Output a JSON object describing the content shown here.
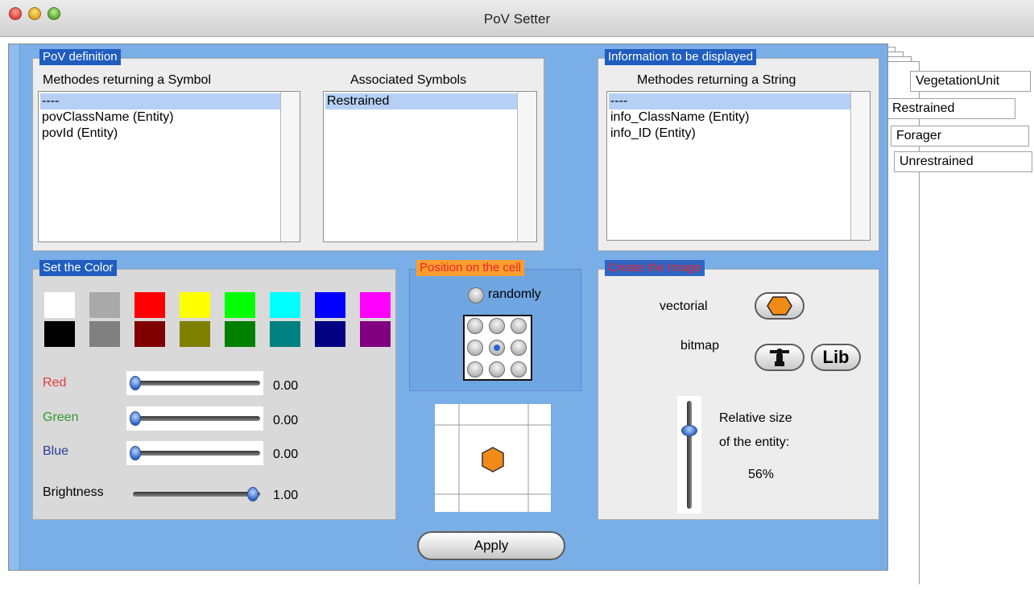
{
  "window": {
    "title": "PoV Setter"
  },
  "tabs": [
    "VegetationUnit",
    "Restrained",
    "Forager",
    "Unrestrained"
  ],
  "pov_definition": {
    "title": "PoV definition",
    "methods_label": "Methodes returning a Symbol",
    "methods": [
      "----",
      "povClassName (Entity)",
      "povId (Entity)"
    ],
    "symbols_label": "Associated Symbols",
    "symbols": [
      "Restrained"
    ]
  },
  "information": {
    "title": "Information to be displayed",
    "methods_label": "Methodes returning a String",
    "methods": [
      "----",
      "info_ClassName (Entity)",
      "info_ID (Entity)"
    ]
  },
  "color": {
    "title": "Set the Color",
    "swatches_top": [
      "#ffffff",
      "#a9a9a9",
      "#ff0000",
      "#ffff00",
      "#00ff00",
      "#00ffff",
      "#0000ff",
      "#ff00ff"
    ],
    "swatches_bottom": [
      "#000000",
      "#808080",
      "#800000",
      "#808000",
      "#008000",
      "#008080",
      "#000080",
      "#800080"
    ],
    "red_label": "Red",
    "red_value": "0.00",
    "red_color": "#e33b3b",
    "green_label": "Green",
    "green_value": "0.00",
    "green_color": "#2f9a2f",
    "blue_label": "Blue",
    "blue_value": "0.00",
    "blue_color": "#2b3a9c",
    "brightness_label": "Brightness",
    "brightness_value": "1.00",
    "red_level": 0.0,
    "green_level": 0.0,
    "blue_level": 0.0,
    "brightness_level": 1.0
  },
  "position": {
    "title": "Position on the cell",
    "randomly_label": "randomly",
    "selected_cell": "center"
  },
  "image": {
    "title": "Create the Image",
    "vectorial_label": "vectorial",
    "bitmap_label": "bitmap",
    "lib_label": "Lib",
    "size_label_line1": "Relative size",
    "size_label_line2": "of the entity:",
    "size_value": "56%",
    "entity_color": "#f28a18"
  },
  "apply_label": "Apply"
}
